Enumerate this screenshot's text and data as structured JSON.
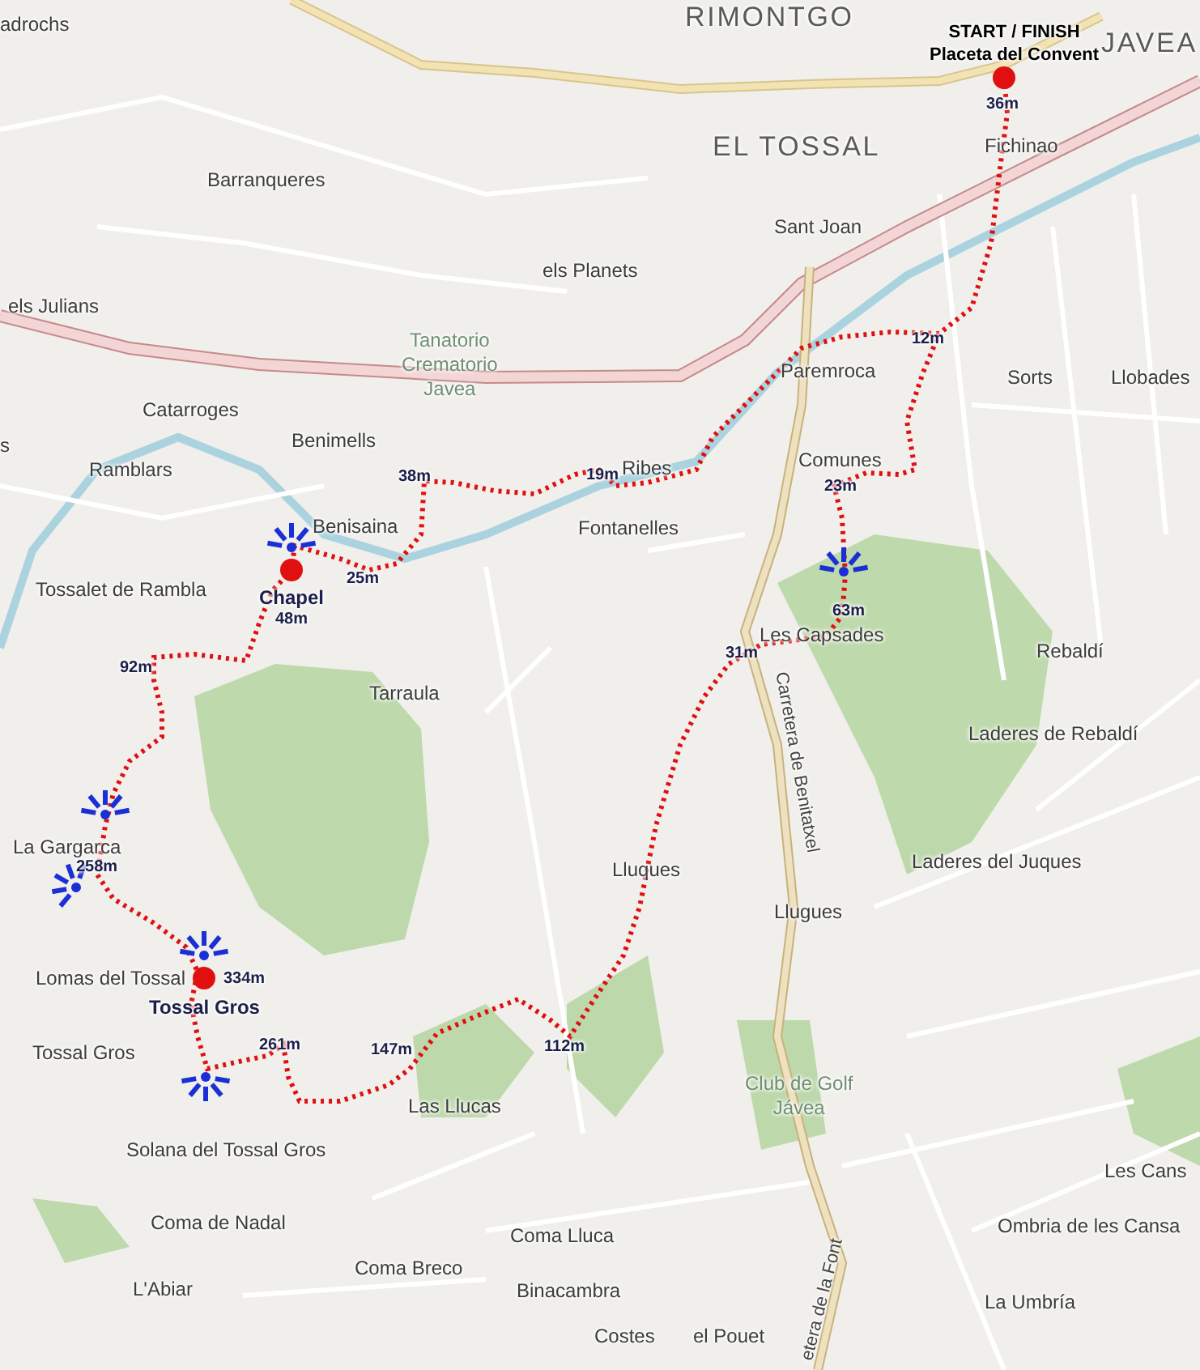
{
  "map": {
    "places": [
      {
        "text": "adrochs",
        "kind": "locality"
      },
      {
        "text": "RIMONTGO",
        "kind": "district"
      },
      {
        "text": "JAVEA",
        "kind": "district"
      },
      {
        "text": "EL TOSSAL",
        "kind": "district"
      },
      {
        "text": "Fichinao",
        "kind": "locality"
      },
      {
        "text": "Barranqueres",
        "kind": "locality"
      },
      {
        "text": "Sant Joan",
        "kind": "locality"
      },
      {
        "text": "els Planets",
        "kind": "locality"
      },
      {
        "text": "els Julians",
        "kind": "locality"
      },
      {
        "text": "Tanatorio\nCrematorio\nJavea",
        "kind": "landmark"
      },
      {
        "text": "Paremroca",
        "kind": "locality"
      },
      {
        "text": "Sorts",
        "kind": "locality"
      },
      {
        "text": "Llobades",
        "kind": "locality"
      },
      {
        "text": "Catarroges",
        "kind": "locality"
      },
      {
        "text": "Benimells",
        "kind": "locality"
      },
      {
        "text": "s",
        "kind": "locality"
      },
      {
        "text": "Ramblars",
        "kind": "locality"
      },
      {
        "text": "Ribes",
        "kind": "locality"
      },
      {
        "text": "Comunes",
        "kind": "locality"
      },
      {
        "text": "Benisaina",
        "kind": "locality"
      },
      {
        "text": "Fontanelles",
        "kind": "locality"
      },
      {
        "text": "Tossalet de Rambla",
        "kind": "locality"
      },
      {
        "text": "Les Capsades",
        "kind": "locality"
      },
      {
        "text": "Rebaldí",
        "kind": "locality"
      },
      {
        "text": "Tarraula",
        "kind": "locality"
      },
      {
        "text": "Laderes de Rebaldí",
        "kind": "locality"
      },
      {
        "text": "Carretera de Benitatxel",
        "kind": "road"
      },
      {
        "text": "La Gargarca",
        "kind": "locality"
      },
      {
        "text": "Lluques",
        "kind": "locality"
      },
      {
        "text": "Laderes del Juques",
        "kind": "locality"
      },
      {
        "text": "Llugues",
        "kind": "locality"
      },
      {
        "text": "Lomas del Tossal",
        "kind": "locality"
      },
      {
        "text": "Tossal Gros",
        "kind": "locality"
      },
      {
        "text": "Las Llucas",
        "kind": "locality"
      },
      {
        "text": "Club de Golf\nJávea",
        "kind": "landmark"
      },
      {
        "text": "Solana del Tossal Gros",
        "kind": "locality"
      },
      {
        "text": "Les Cans",
        "kind": "locality"
      },
      {
        "text": "Coma de Nadal",
        "kind": "locality"
      },
      {
        "text": "Ombria de les Cansa",
        "kind": "locality"
      },
      {
        "text": "Coma Lluca",
        "kind": "locality"
      },
      {
        "text": "Coma Breco",
        "kind": "locality"
      },
      {
        "text": "L'Abiar",
        "kind": "locality"
      },
      {
        "text": "Binacambra",
        "kind": "locality"
      },
      {
        "text": "La Umbría",
        "kind": "locality"
      },
      {
        "text": "Costes",
        "kind": "locality"
      },
      {
        "text": "el Pouet",
        "kind": "locality"
      },
      {
        "text": "etera de la Font",
        "kind": "road"
      }
    ]
  },
  "route": {
    "stops": [
      {
        "title": "START / FINISH",
        "subtitle": "Placeta del Convent",
        "elevation": "36m"
      },
      {
        "title": "Chapel",
        "elevation": "48m"
      },
      {
        "title": "Tossal Gros",
        "elevation": "334m"
      }
    ],
    "elevations": [
      "12m",
      "23m",
      "63m",
      "31m",
      "38m",
      "19m",
      "25m",
      "92m",
      "258m",
      "261m",
      "147m",
      "112m"
    ]
  }
}
